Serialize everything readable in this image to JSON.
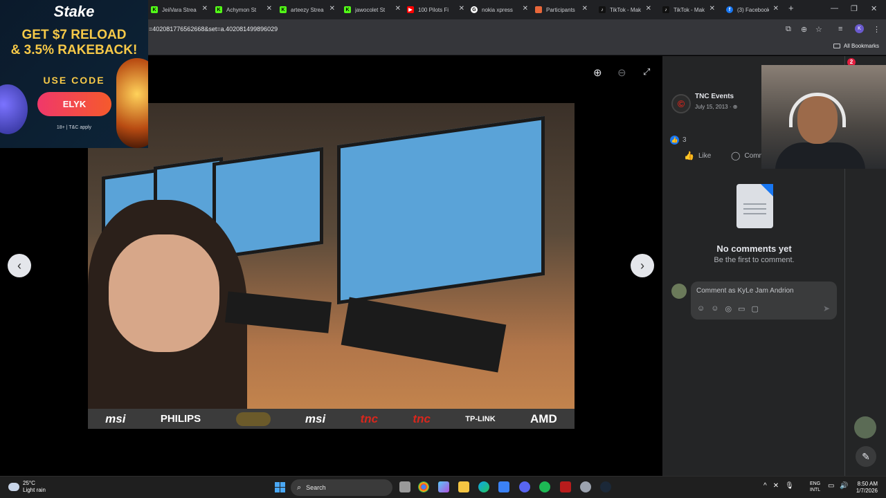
{
  "browser": {
    "tabs": [
      {
        "title": "JeiiVara Strea",
        "icon": "kick-icon",
        "color": "#53fc18"
      },
      {
        "title": "Achymon St",
        "icon": "kick-icon",
        "color": "#53fc18"
      },
      {
        "title": "arteezy Strea",
        "icon": "kick-icon",
        "color": "#53fc18"
      },
      {
        "title": "jawocolet St",
        "icon": "kick-icon",
        "color": "#53fc18"
      },
      {
        "title": "100 Pilots Fi",
        "icon": "youtube-icon",
        "color": "#ff0000"
      },
      {
        "title": "nokia xpress",
        "icon": "google-icon",
        "color": "#ffffff"
      },
      {
        "title": "Participants",
        "icon": "participants-icon",
        "color": "#e8673a"
      },
      {
        "title": "TikTok - Mak",
        "icon": "tiktok-icon",
        "color": "#ffffff"
      },
      {
        "title": "TikTok - Mak",
        "icon": "tiktok-icon",
        "color": "#ffffff"
      },
      {
        "title": "(3) Facebook",
        "icon": "facebook-icon",
        "color": "#1877f2"
      }
    ],
    "url": "=402081776562668&set=a.402081499896029",
    "bookmarks_label": "All Bookmarks",
    "profile_initial": "K"
  },
  "ad": {
    "brand": "Stake",
    "headline_1": "GET $7 RELOAD",
    "headline_2": "& 3.5% RAKEBACK!",
    "code_label": "USE CODE",
    "code": "ELYK",
    "terms": "18+ | T&C apply"
  },
  "photo": {
    "sponsors": [
      "msi",
      "PHILIPS",
      "",
      "msi",
      "tnc",
      "tnc",
      "TP-LINK",
      "AMD"
    ]
  },
  "post": {
    "page_name": "TNC Events",
    "date": "July 15, 2013 · ",
    "like_count": "3",
    "like_label": "Like",
    "comment_label": "Comm",
    "no_comments_title": "No comments yet",
    "no_comments_sub": "Be the first to comment.",
    "comment_placeholder": "Comment as KyLe Jam Andrion"
  },
  "notifications": {
    "count": "2"
  },
  "taskbar": {
    "temperature": "25°C",
    "weather": "Light rain",
    "search_label": "Search",
    "lang_1": "ENG",
    "lang_2": "INTL",
    "time": "8:50 AM",
    "date": "1/7/2026"
  },
  "colors": {
    "facebook_blue": "#1877f2",
    "panel_bg": "#242526",
    "stake_gold": "#f7c948"
  }
}
